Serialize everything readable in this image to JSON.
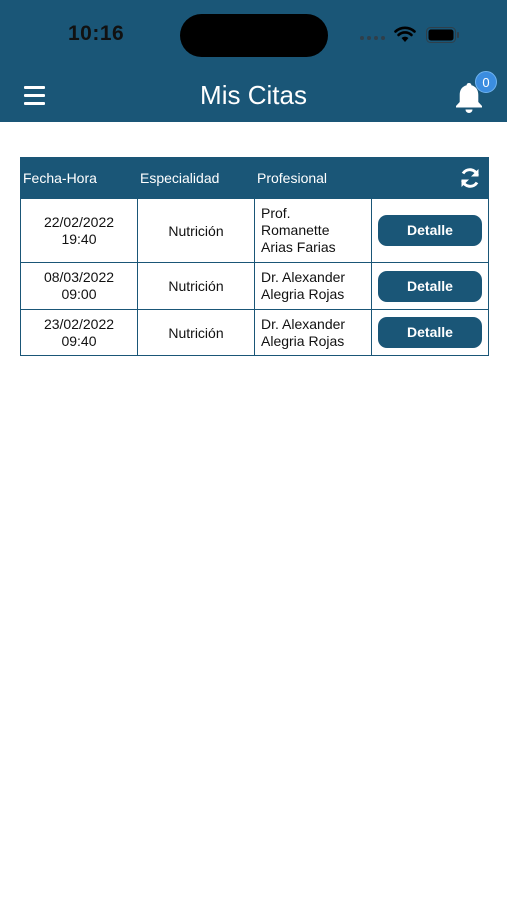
{
  "status_bar": {
    "time": "10:16"
  },
  "header": {
    "title": "Mis Citas",
    "notification_count": "0"
  },
  "table": {
    "headers": [
      "Fecha-Hora",
      "Especialidad",
      "Profesional",
      ""
    ],
    "rows": [
      {
        "date": "22/02/2022",
        "time": "19:40",
        "specialty": "Nutrición",
        "professional": [
          "Prof.",
          "Romanette",
          "Arias Farias"
        ],
        "button": "Detalle"
      },
      {
        "date": "08/03/2022",
        "time": "09:00",
        "specialty": "Nutrición",
        "professional": [
          "Dr. Alexander",
          "Alegria Rojas"
        ],
        "button": "Detalle"
      },
      {
        "date": "23/02/2022",
        "time": "09:40",
        "specialty": "Nutrición",
        "professional": [
          "Dr. Alexander",
          "Alegria Rojas"
        ],
        "button": "Detalle"
      }
    ]
  },
  "colors": {
    "primary": "#1a5677",
    "badge": "#3b8de0",
    "background": "#ffffff"
  },
  "icons": {
    "menu": "hamburger-icon",
    "notifications": "bell-icon",
    "refresh": "refresh-icon"
  }
}
